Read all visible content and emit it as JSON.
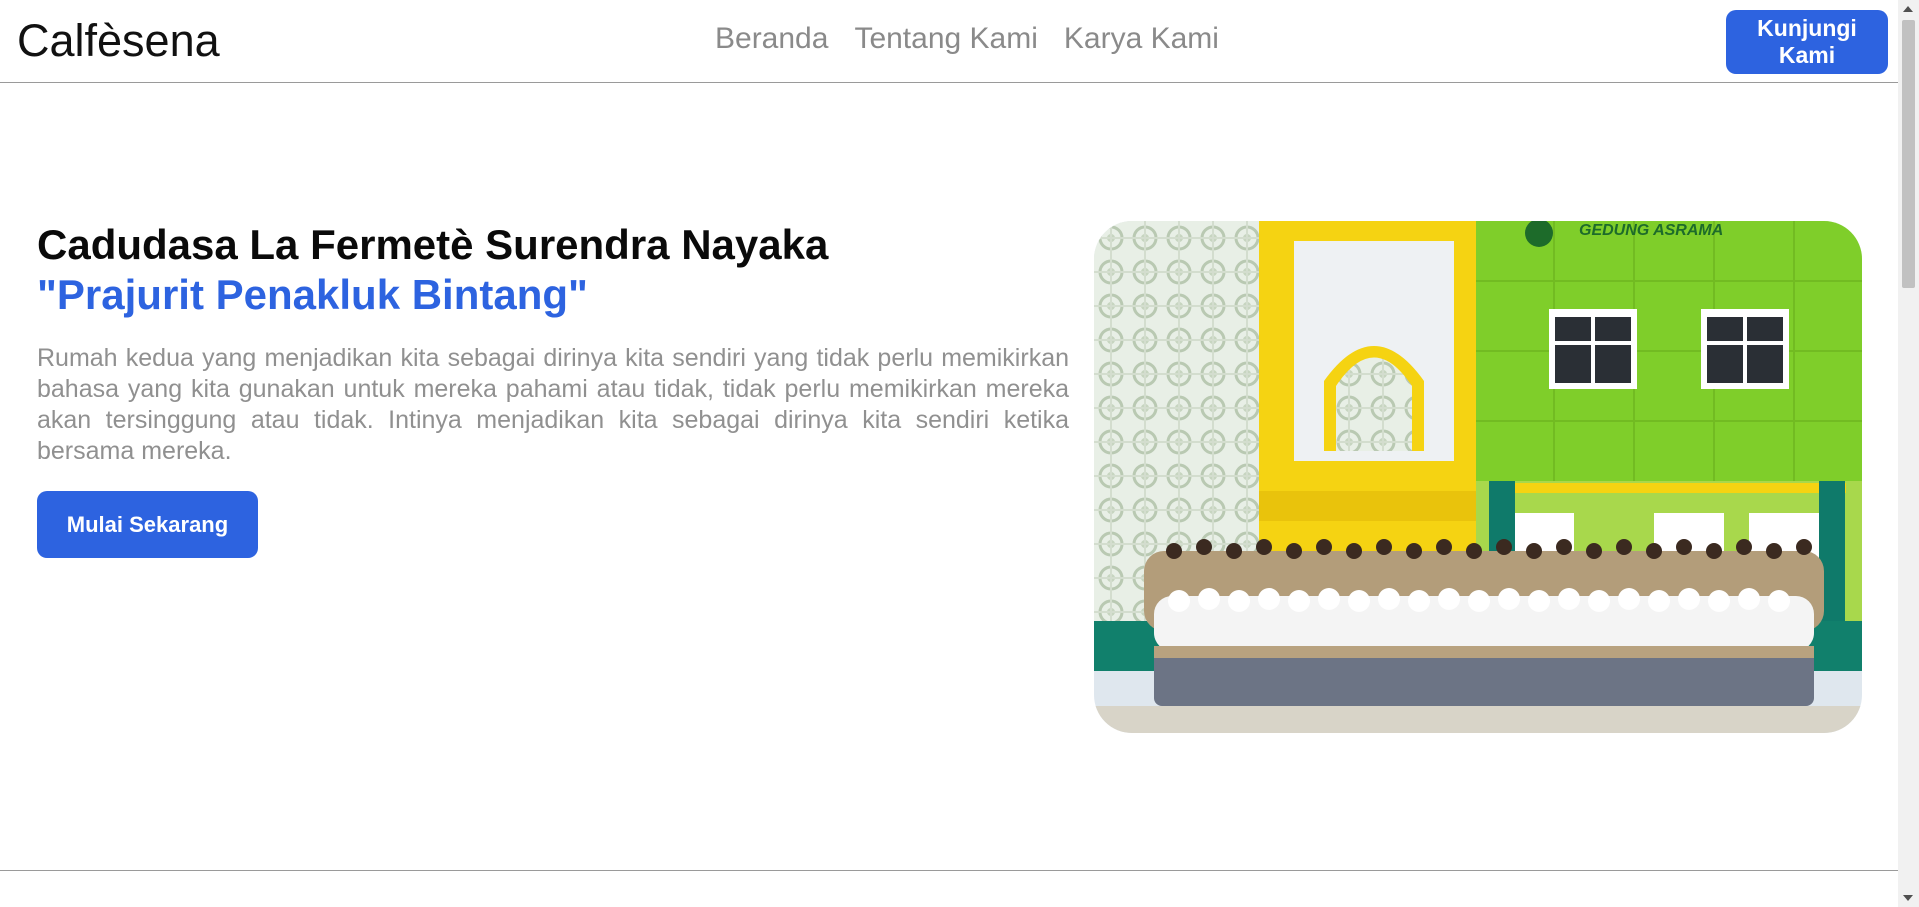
{
  "header": {
    "brand": "Calfèsena",
    "nav": [
      "Beranda",
      "Tentang Kami",
      "Karya Kami"
    ],
    "cta_label": "Kunjungi Kami"
  },
  "hero": {
    "title": "Cadudasa La Fermetè Surendra Nayaka",
    "subtitle": "\"Prajurit Penakluk Bintang\"",
    "description": "Rumah kedua yang menjadikan kita sebagai dirinya kita sendiri yang tidak perlu memikirkan bahasa yang kita gunakan untuk mereka pahami atau tidak, tidak perlu memikirkan mereka akan tersinggung atau tidak. Intinya menjadikan kita sebagai dirinya kita sendiri ketika bersama mereka.",
    "button_label": "Mulai Sekarang"
  },
  "photo": {
    "building_sign": "GEDUNG ASRAMA"
  },
  "colors": {
    "accent": "#2d63e0",
    "muted_text": "#909090",
    "building_green": "#7fce2a",
    "building_yellow": "#f5d312"
  }
}
